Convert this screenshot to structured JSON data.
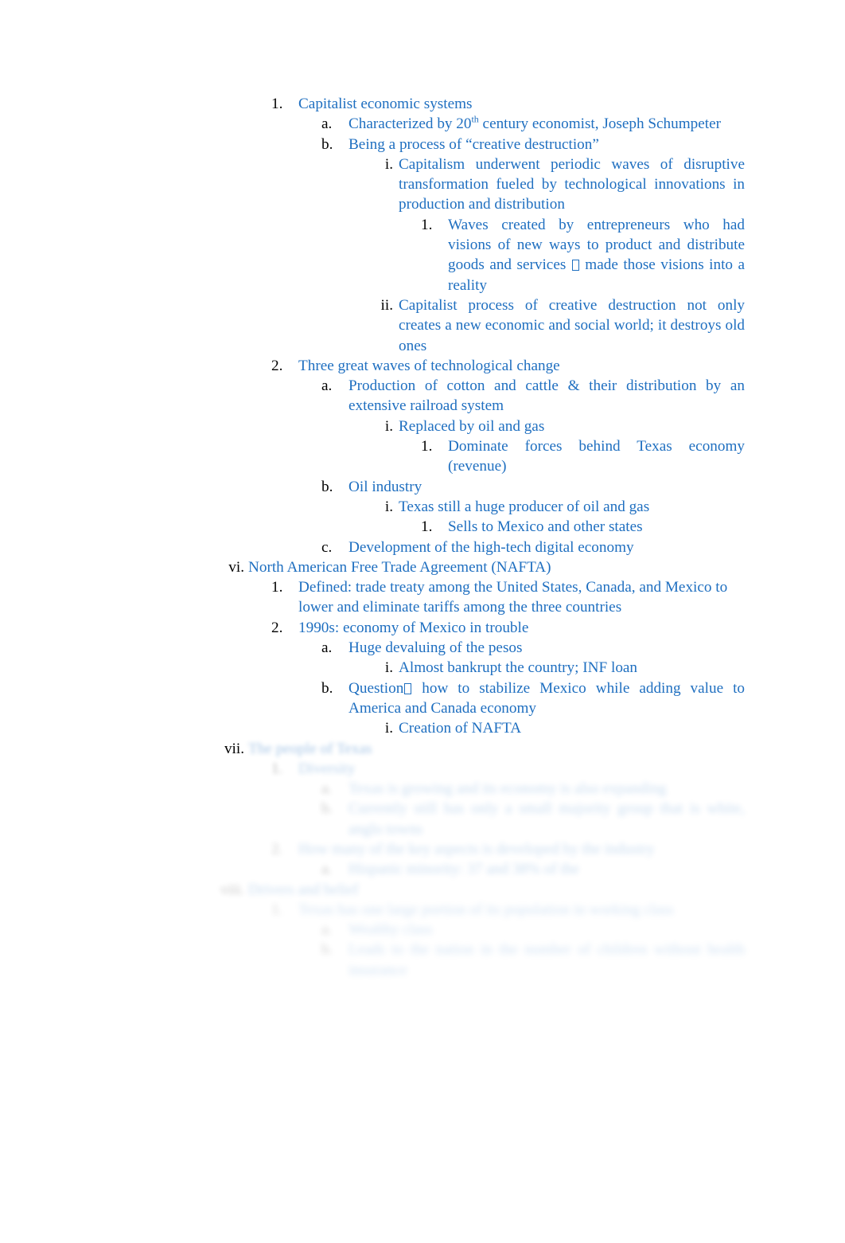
{
  "document": {
    "type": "outline-notes",
    "text_color": "#1F6FC0",
    "marker_color": "#000000",
    "page_background": "#FFFFFF",
    "alignment": "justified"
  },
  "outline": [
    {
      "id": "l2-1",
      "level": "decimal",
      "marker": "1.",
      "text": "Capitalist economic systems"
    },
    {
      "id": "l3-1a",
      "level": "alpha",
      "marker": "a.",
      "text_pre": "Characterized by 20",
      "superscript": "th",
      "text_post": " century economist, Joseph Schumpeter"
    },
    {
      "id": "l3-1b",
      "level": "alpha",
      "marker": "b.",
      "text": "Being a process of “creative destruction”"
    },
    {
      "id": "l4-1b-i",
      "level": "lower-roman",
      "marker": "i.",
      "text": "Capitalism underwent periodic waves of disruptive transformation fueled by technological innovations in production and distribution"
    },
    {
      "id": "l5-1b-i-1",
      "level": "decimal-deep",
      "marker": "1.",
      "text_pre": "Waves created by entrepreneurs who had visions of new ways to product and distribute goods and services ",
      "glyph": "missing-glyph-box",
      "text_post": "  made those visions into a reality"
    },
    {
      "id": "l4-1b-ii",
      "level": "lower-roman",
      "marker": "ii.",
      "text": "Capitalist process of creative destruction not only creates a new economic and social world; it destroys old ones"
    },
    {
      "id": "l2-2",
      "level": "decimal",
      "marker": "2.",
      "text": "Three great waves of technological change"
    },
    {
      "id": "l3-2a",
      "level": "alpha",
      "marker": "a.",
      "text": "Production of cotton and cattle & their distribution by an extensive railroad system"
    },
    {
      "id": "l4-2a-i",
      "level": "lower-roman",
      "marker": "i.",
      "text": "Replaced by oil and gas"
    },
    {
      "id": "l5-2a-i-1",
      "level": "decimal-deep",
      "marker": "1.",
      "text": "Dominate forces behind Texas economy (revenue)"
    },
    {
      "id": "l3-2b",
      "level": "alpha",
      "marker": "b.",
      "text": "Oil industry"
    },
    {
      "id": "l4-2b-i",
      "level": "lower-roman",
      "marker": "i.",
      "text": "Texas still a huge producer of oil and gas"
    },
    {
      "id": "l5-2b-i-1",
      "level": "decimal-deep",
      "marker": "1.",
      "text": "Sells to Mexico and other states"
    },
    {
      "id": "l3-2c",
      "level": "alpha",
      "marker": "c.",
      "text": "Development of the high-tech digital economy"
    },
    {
      "id": "l1-vi",
      "level": "roman",
      "marker": "vi.",
      "text": "North American Free Trade Agreement (NAFTA)"
    },
    {
      "id": "l2-vi-1",
      "level": "decimal",
      "marker": "1.",
      "text": "Defined: trade treaty among the United States, Canada, and Mexico to lower and eliminate tariffs among the three countries"
    },
    {
      "id": "l2-vi-2",
      "level": "decimal",
      "marker": "2.",
      "text": "1990s: economy of Mexico in trouble"
    },
    {
      "id": "l3-vi-2a",
      "level": "alpha",
      "marker": "a.",
      "text": "Huge devaluing of the pesos"
    },
    {
      "id": "l4-vi-2a-i",
      "level": "lower-roman",
      "marker": "i.",
      "text": "Almost bankrupt the country; INF loan"
    },
    {
      "id": "l3-vi-2b",
      "level": "alpha",
      "marker": "b.",
      "text_pre": "Question",
      "glyph": "missing-glyph-box",
      "text_post": "  how to stabilize Mexico while adding value to America and Canada economy"
    },
    {
      "id": "l4-vi-2b-i",
      "level": "lower-roman",
      "marker": "i.",
      "text": "Creation of NAFTA"
    }
  ],
  "faded_outline": {
    "note": "lower portion of the page is blurred and illegible",
    "items": [
      {
        "id": "l1-vii",
        "level": "roman",
        "marker": "vii.",
        "text": "The people of Texas",
        "fade": 1
      },
      {
        "id": "l2-vii-1",
        "level": "decimal",
        "marker": "1.",
        "text": "Diversity",
        "fade": 2
      },
      {
        "id": "l3-vii-1a",
        "level": "alpha",
        "marker": "a.",
        "text": "Texas is growing and its economy is also expanding",
        "fade": 3
      },
      {
        "id": "l3-vii-1b",
        "level": "alpha",
        "marker": "b.",
        "text": "Currently still has only a small majority group that is white, anglo towns",
        "fade": 3
      },
      {
        "id": "l2-vii-2",
        "level": "decimal",
        "marker": "2.",
        "text": "How many of the key aspects is developed by the industry",
        "fade": 3
      },
      {
        "id": "l3-vii-2a",
        "level": "alpha",
        "marker": "a.",
        "text": "Hispanic minority: 37 and 38% of the",
        "fade": 3
      },
      {
        "id": "l1-viii",
        "level": "roman",
        "marker": "viii.",
        "text": "Drivers and belief",
        "fade": 3
      },
      {
        "id": "l2-viii-1",
        "level": "decimal",
        "marker": "1.",
        "text": "Texas has one large portion of its population in working class",
        "fade": 4
      },
      {
        "id": "l3-viii-1a",
        "level": "alpha",
        "marker": "a.",
        "text": "Wealthy class",
        "fade": 4
      },
      {
        "id": "l3-viii-1b",
        "level": "alpha",
        "marker": "b.",
        "text": "Leads to the nation in the number of children without health insurance",
        "fade": 4
      }
    ]
  }
}
